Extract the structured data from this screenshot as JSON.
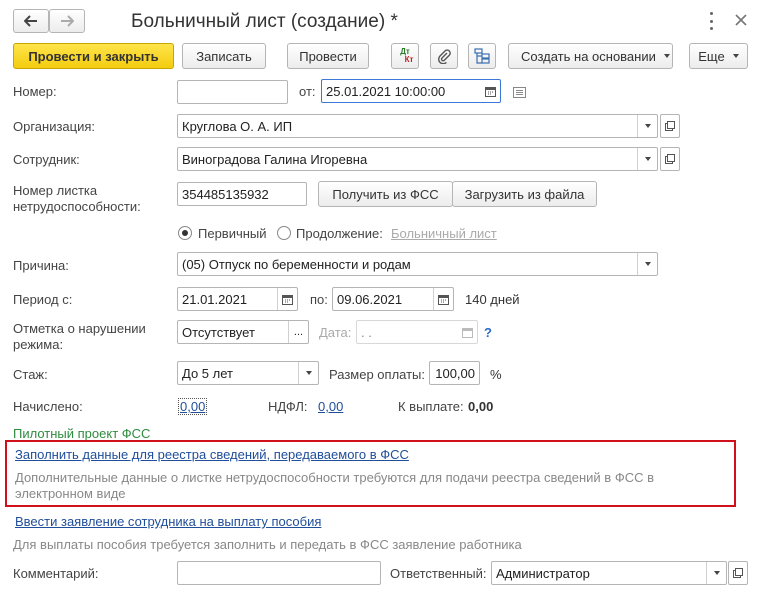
{
  "window": {
    "title": "Больничный лист (создание) *"
  },
  "toolbar": {
    "post_close": "Провести и закрыть",
    "save": "Записать",
    "post": "Провести",
    "dtkt_top": "Дт",
    "dtkt_bottom": "Кт",
    "create_based": "Создать на основании",
    "more": "Еще"
  },
  "form": {
    "number_label": "Номер:",
    "number_value": "",
    "date_label": "от:",
    "date_value": "25.01.2021 10:00:00",
    "org_label": "Организация:",
    "org_value": "Круглова О. А. ИП",
    "employee_label": "Сотрудник:",
    "employee_value": "Виноградова Галина Игоревна",
    "sheet_label_1": "Номер листка",
    "sheet_label_2": "нетрудоспособности:",
    "sheet_value": "354485135932",
    "get_fss": "Получить из ФСС",
    "load_file": "Загрузить из файла",
    "radio_primary": "Первичный",
    "radio_continue": "Продолжение:",
    "sick_list_link": "Больничный лист",
    "reason_label": "Причина:",
    "reason_value": "(05) Отпуск по беременности и родам",
    "period_label": "Период с:",
    "period_from": "21.01.2021",
    "period_to_label": "по:",
    "period_to": "09.06.2021",
    "days": "140 дней",
    "violation_label_1": "Отметка о нарушении",
    "violation_label_2": "режима:",
    "violation_value": "Отсутствует",
    "violation_dots": "...",
    "violation_date_label": "Дата:",
    "violation_date_value": " .  .",
    "question": "?",
    "stazh_label": "Стаж:",
    "stazh_value": "До 5 лет",
    "pay_size_label": "Размер оплаты:",
    "pay_size_value": "100,00",
    "percent": "%",
    "accrued_label": "Начислено:",
    "accrued_value": "0,00",
    "ndfl_label": "НДФЛ:",
    "ndfl_value": "0,00",
    "to_pay_label": "К выплате:",
    "to_pay_value": "0,00",
    "pilot_project": "Пилотный проект ФСС",
    "fill_registry_link": "Заполнить данные для реестра сведений, передаваемого в ФСС",
    "registry_hint": "Дополнительные данные о листке нетрудоспособности требуются для подачи реестра сведений в ФСС в электронном виде",
    "employee_application_link": "Ввести заявление сотрудника на выплату пособия",
    "application_hint": "Для выплаты пособия требуется заполнить и передать в ФСС заявление работника",
    "comment_label": "Комментарий:",
    "comment_value": "",
    "responsible_label": "Ответственный:",
    "responsible_value": "Администратор"
  },
  "colors": {
    "primary_button": "#f4cc10",
    "link": "#1f4e9a",
    "pilot_green": "#2e8b3e",
    "highlight_border": "#d0101a"
  }
}
